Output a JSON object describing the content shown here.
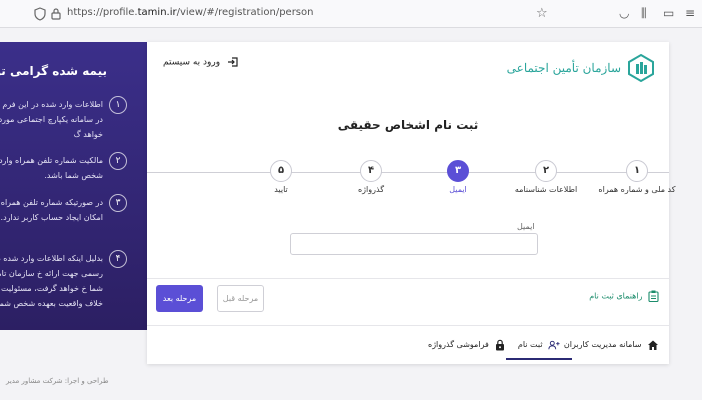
{
  "browser": {
    "url_prefix": "https://profile.",
    "url_domain": "tamin.ir",
    "url_suffix": "/view/#/registration/person",
    "icons": [
      "shield-icon",
      "lock-icon",
      "star-icon",
      "pocket-icon",
      "library-icon",
      "sidebar-icon",
      "menu-icon"
    ]
  },
  "header": {
    "org_name": "سازمان تأمین اجتماعی",
    "login_label": "ورود به سیستم"
  },
  "form": {
    "title": "ثبت نام اشخاص حقیقی",
    "steps": [
      {
        "num": "۱",
        "label": "کد ملی و شماره همراه",
        "active": false
      },
      {
        "num": "۲",
        "label": "اطلاعات شناسنامه",
        "active": false
      },
      {
        "num": "۳",
        "label": "ایمیل",
        "active": true
      },
      {
        "num": "۴",
        "label": "گذرواژه",
        "active": false
      },
      {
        "num": "۵",
        "label": "تایید",
        "active": false
      }
    ],
    "email_label": "ایمیل",
    "email_value": "",
    "next_label": "مرحله بعد",
    "prev_label": "مرحله قبل",
    "guide_label": "راهنمای ثبت نام"
  },
  "panel": {
    "title": "بیمه شده گرامی توجه داشت",
    "notices": [
      {
        "num": "۱",
        "text": "اطلاعات وارد شده در این فرم ا شناسایی شما در سامانه یکپارچ اجتماعی مورد استفاده قرار خواهد گ"
      },
      {
        "num": "۲",
        "text": "مالکیت شماره تلفن همراه وارد شد متعلق به شخص شما باشد."
      },
      {
        "num": "۳",
        "text": "در صورتیکه شماره تلفن همراه وار شما نباشد امکان ایجاد حساب کاربر ندارد."
      },
      {
        "num": "۴",
        "text": "بدلیل اینکه اطلاعات وارد شده در ز پس بصورت رسمی جهت ارائه خ سازمان تامین اجتماعی به شما خ خواهد گرفت، مسئولیت وارد نمودن خلاف واقعیت بعهده شخص شما خ"
      }
    ]
  },
  "nav": {
    "management": "سامانه مدیریت کاربران",
    "register": "ثبت نام",
    "forgot": "فراموشی گذرواژه"
  },
  "footer": {
    "text": "طراحی و اجرا: شرکت مشاور مدیر"
  },
  "colors": {
    "accent": "#5b4fd6",
    "panel": "#2c1f63",
    "brand": "#2aa59b",
    "guide": "#1b8c6b"
  }
}
